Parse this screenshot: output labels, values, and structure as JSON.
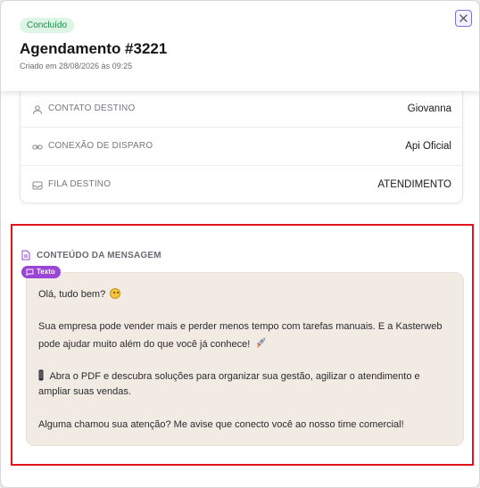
{
  "header": {
    "status": "Concluído",
    "title": "Agendamento #3221",
    "subtitle": "Criado em 28/08/2026 às 09:25",
    "close_icon": "close-icon"
  },
  "details": [
    {
      "label": "CONTATO DESTINO",
      "value": "Giovanna",
      "icon": "user-icon"
    },
    {
      "label": "CONEXÃO DE DISPARO",
      "value": "Api Oficial",
      "icon": "link-icon"
    },
    {
      "label": "FILA DESTINO",
      "value": "ATENDIMENTO",
      "icon": "inbox-icon"
    }
  ],
  "message": {
    "section_title": "CONTEÚDO DA MENSAGEM",
    "type_tag": "Texto",
    "lines": [
      "Olá, tudo bem?",
      "Sua empresa pode vender mais e perder menos tempo com tarefas manuais. E a Kasterweb",
      "pode ajudar muito além do que você já conhece!",
      "Abra o PDF e descubra soluções para organizar sua gestão, agilizar o atendimento e",
      "ampliar suas vendas.",
      "Alguma chamou sua atenção? Me avise que conecto você ao nosso time comercial!"
    ]
  },
  "colors": {
    "status_bg": "#dcf5e4",
    "status_text": "#1e8a4a",
    "accent_purple": "#9a45d6",
    "bubble_bg": "#f2ebe3",
    "highlight_border": "#e0141a"
  }
}
